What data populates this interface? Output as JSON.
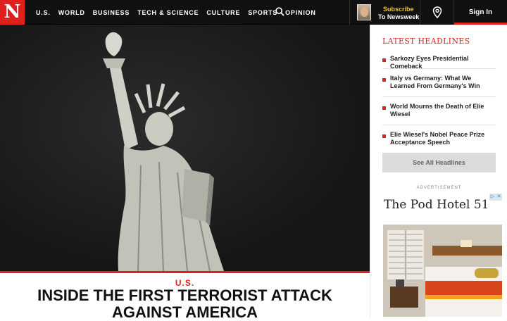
{
  "logo": "N",
  "nav": {
    "items": [
      "U.S.",
      "WORLD",
      "BUSINESS",
      "TECH & SCIENCE",
      "CULTURE",
      "SPORTS",
      "OPINION"
    ]
  },
  "subscribe": {
    "line1": "Subscribe",
    "line2": "To Newsweek"
  },
  "signin": "Sign In",
  "article": {
    "kicker": "U.S.",
    "headline": "INSIDE THE FIRST TERRORIST ATTACK AGAINST AMERICA"
  },
  "sidebar": {
    "title": "LATEST HEADLINES",
    "headlines": [
      "Sarkozy Eyes Presidential Comeback",
      "Italy vs Germany: What We Learned From Germany's Win",
      "World Mourns the Death of Elie Wiesel",
      "Elie Wiesel's Nobel Peace Prize Acceptance Speech"
    ],
    "see_all": "See All Headlines"
  },
  "ad": {
    "label": "ADVERTISEMENT",
    "title": "The Pod Hotel 51"
  },
  "colors": {
    "brand": "#e0201f",
    "nav_bg": "#111111",
    "accent_yellow": "#f5c518"
  }
}
